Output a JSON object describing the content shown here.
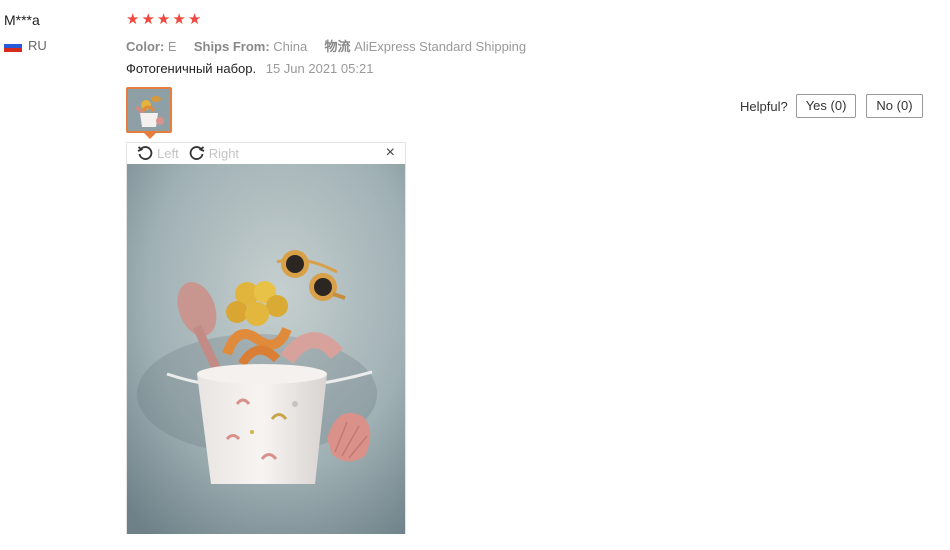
{
  "review": {
    "user_name": "M***a",
    "country": "RU",
    "rating": 5,
    "color_label": "Color:",
    "color_value": "E",
    "ships_label": "Ships From:",
    "ships_value": "China",
    "shipping_label": "物流",
    "shipping_value": "AliExpress Standard Shipping",
    "text": "Фотогеничный набор.",
    "date": "15 Jun 2021 05:21"
  },
  "viewer": {
    "left_label": "Left",
    "right_label": "Right",
    "close_glyph": "×"
  },
  "helpful": {
    "label": "Helpful?",
    "yes_label": "Yes (0)",
    "no_label": "No (0)"
  },
  "colors": {
    "star": "#f0473e",
    "thumb_border": "#e57d3c"
  },
  "icons": [
    "star-icon",
    "rotate-left-icon",
    "rotate-right-icon",
    "close-icon",
    "flag-ru-icon"
  ]
}
